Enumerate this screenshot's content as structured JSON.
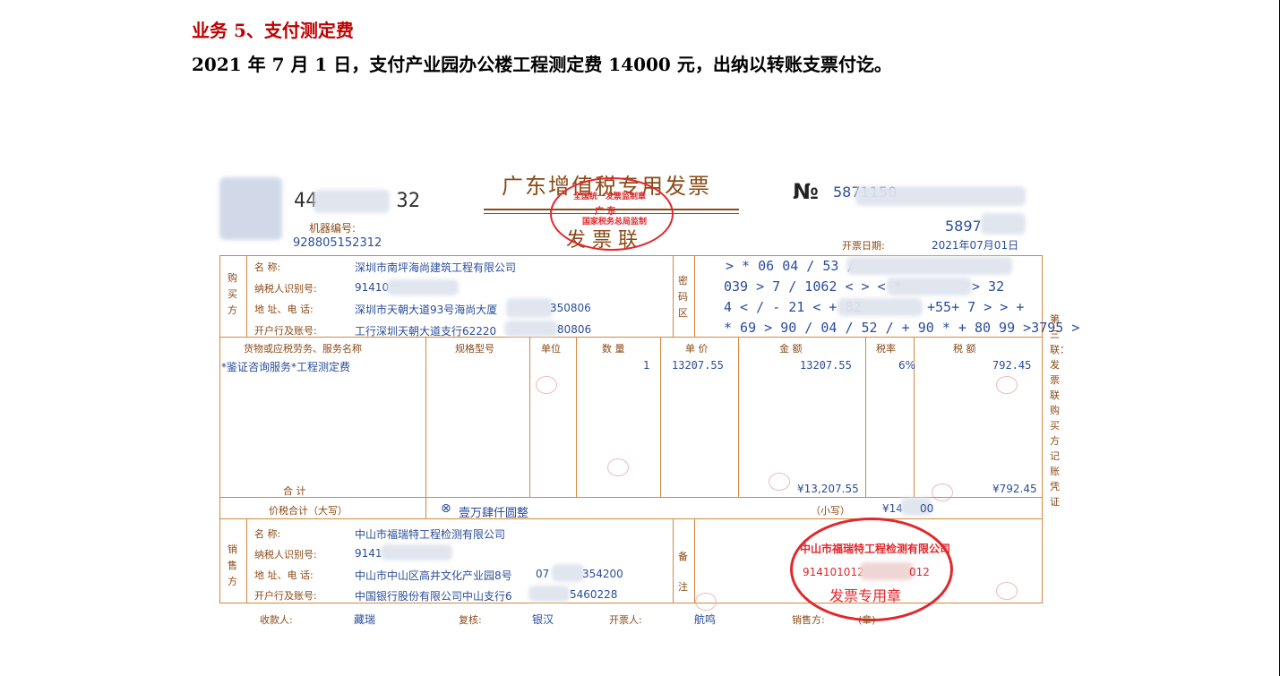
{
  "heading": {
    "title": "业务 5、支付测定费",
    "line": "2021 年 7 月 1 日，支付产业园办公楼工程测定费 14000 元，出纳以转账支票付讫。"
  },
  "invoice": {
    "code_a": "44",
    "code_b": "32",
    "title": "广东增值税专用发票",
    "no_symbol": "№",
    "no_value": "58",
    "no_value_tail": "71150",
    "no_value2": "5897",
    "machine_label": "机器编号:",
    "machine_no": "928805152312",
    "date_label": "开票日期:",
    "date": "2021年07月01日",
    "sheet_label": "发 票 联",
    "buyer": {
      "side_label": "购买方",
      "name_label": "名          称:",
      "name": "深圳市南坪海尚建筑工程有限公司",
      "tax_label": "纳税人识别号:",
      "tax": "91410",
      "addr_label": "地 址、电 话:",
      "addr": "深圳市天朝大道93号海尚大厦",
      "addr_tail": "350806",
      "bank_label": "开户行及账号:",
      "bank": "工行深圳天朝大道支行62220",
      "bank_tail": "80806"
    },
    "cipher_label": "密码区",
    "cipher": [
      "> * 06 04 / 53 /",
      "039 > 7 / 1062 < > < *",
      "4 < / - 21 < + 82",
      "* 69 > 90 / 04 / 52 / + 90 * + 80 99  >3795 >"
    ],
    "cipher_tails": [
      "",
      "> 32",
      "+55+ 7 > > +",
      ""
    ],
    "columns": [
      "货物或应税劳务、服务名称",
      "规格型号",
      "单位",
      "数 量",
      "单 价",
      "金 额",
      "税率",
      "税 额"
    ],
    "items": [
      {
        "name": "*鉴证咨询服务*工程测定费",
        "spec": "",
        "unit": "",
        "qty": "1",
        "price": "13207.55",
        "amount": "13207.55",
        "rate": "6%",
        "tax": "792.45"
      }
    ],
    "total_label": "合          计",
    "total_amount": "¥13,207.55",
    "total_tax": "¥792.45",
    "cap_label": "价税合计（大写）",
    "cap_symbol": "⊗",
    "cap_value": "壹万肆仟圆整",
    "small_label": "（小写）",
    "small_value": "¥14",
    "small_tail": "00",
    "seller": {
      "side_label": "销售方",
      "name_label": "名          称:",
      "name": "中山市福瑞特工程检测有限公司",
      "tax_label": "纳税人识别号:",
      "tax": "9141",
      "addr_label": "地 址、电 话:",
      "addr": "中山市中山区高井文化产业园8号",
      "addr_tail": "354200",
      "addr_prefix": "07",
      "bank_label": "开户行及账号:",
      "bank": "中国银行股份有限公司中山支行6",
      "bank_tail": "5460228"
    },
    "remark_label": "备注",
    "footer": {
      "payee_label": "收款人:",
      "payee": "藏瑞",
      "review_label": "复核:",
      "review": "银汉",
      "issuer_label": "开票人:",
      "issuer": "航鸣",
      "seller_label": "销售方:",
      "seller_stamp": "(章)"
    },
    "side_note": "第三联：发票联　购买方记账凭证",
    "stamp_tax": {
      "top": "全国统一发票监制章",
      "mid": "广 东",
      "bottom": "国家税务总局监制"
    },
    "stamp_seller": {
      "top": "中山市福瑞特工程检测有限公司",
      "code": "914101012",
      "code_b": "012",
      "bottom": "发票专用章"
    }
  }
}
